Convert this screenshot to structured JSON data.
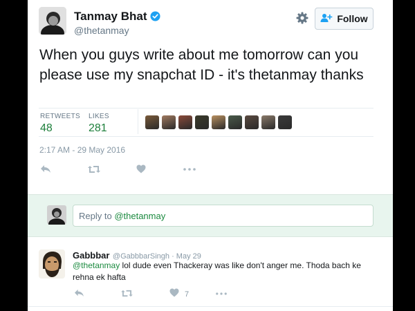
{
  "tweet": {
    "author_name": "Tanmay Bhat",
    "author_handle": "@thetanmay",
    "follow_label": "Follow",
    "text": "When you  guys write about me tomorrow can you please use my snapchat ID - it's thetanmay thanks",
    "retweets_label": "RETWEETS",
    "retweets_count": "48",
    "likes_label": "LIKES",
    "likes_count": "281",
    "timestamp": "2:17 AM - 29 May 2016",
    "liker_avatar_colors": [
      "#7a5a3a",
      "#a07a60",
      "#8a4a3a",
      "#3a3a2a",
      "#b89060",
      "#4a5a4a",
      "#5a4a40",
      "#8a7a6a",
      "#3a3a3a"
    ]
  },
  "reply_box": {
    "placeholder_prefix": "Reply to ",
    "placeholder_mention": "@thetanmay"
  },
  "reply": {
    "author_name": "Gabbbar",
    "meta": "@GabbbarSingh · May 29",
    "mention": "@thetanmay",
    "text": " lol dude even Thackeray was like don't anger me. Thoda bach ke rehna ek hafta",
    "likes_count": "7"
  },
  "colors": {
    "accent_green": "#1b8a3f",
    "verified_blue": "#1da1f2",
    "icon_gray": "#aab8c2"
  }
}
